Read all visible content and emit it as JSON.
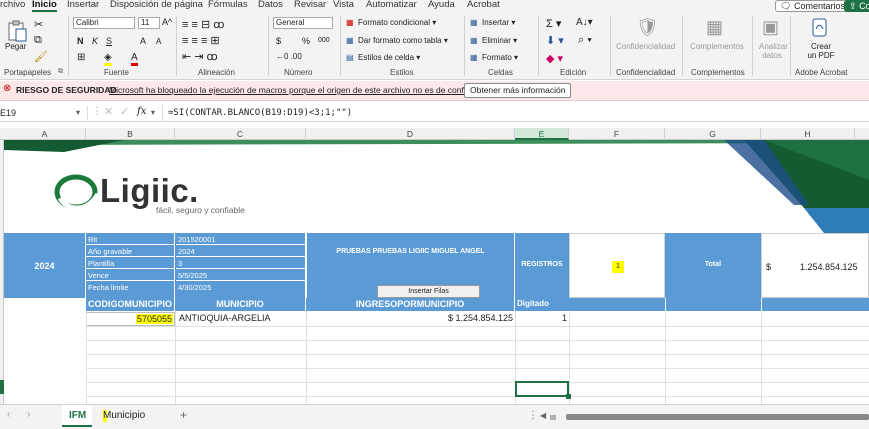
{
  "menu": [
    "rchivo",
    "Inicio",
    "Insertar",
    "Disposición de página",
    "Fórmulas",
    "Datos",
    "Revisar",
    "Vista",
    "Automatizar",
    "Ayuda",
    "Acrobat"
  ],
  "top_buttons": {
    "comments": "Comentarios",
    "share": "Comp"
  },
  "ribbon": {
    "paste": "Pegar",
    "font_name": "Calibri",
    "font_size": "11",
    "bold": "N",
    "italic": "K",
    "underline": "S",
    "grow": "A",
    "shrink": "A",
    "number_format": "General",
    "currency": "$",
    "percent": "%",
    "thousands": "000",
    "cond_format": "Formato condicional",
    "table_format": "Dar formato como tabla",
    "cell_styles": "Estilos de celda",
    "insert": "Insertar",
    "delete": "Eliminar",
    "format": "Formato",
    "conf": "Confidencialidad",
    "compl": "Complementos",
    "analyze": "Analizar datos",
    "create_pdf": "Crear un PDF",
    "groups": [
      "Portapapeles",
      "Fuente",
      "Alineación",
      "Número",
      "Estilos",
      "Celdas",
      "Edición",
      "Confidencialidad",
      "Complementos",
      "Adobe Acrobat"
    ]
  },
  "security": {
    "label": "RIESGO DE SEGURIDAD",
    "message": "Microsoft ha bloqueado la ejecución de macros porque el origen de este archivo no es de confianza.",
    "button": "Obtener más información"
  },
  "formula_bar": {
    "name_box": "E19",
    "fx": "fx",
    "formula": "=SI(CONTAR.BLANCO(B19:D19)<3;1;\"\")"
  },
  "columns": [
    "A",
    "B",
    "C",
    "D",
    "E",
    "F",
    "G",
    "H"
  ],
  "logo": {
    "name": "Ligiic.",
    "tagline": "fácil, seguro y confiable"
  },
  "sheet": {
    "year": "2024",
    "details": [
      [
        "Rit",
        "201520001"
      ],
      [
        "Año gravable",
        "2024"
      ],
      [
        "Plantilla",
        "3"
      ],
      [
        "Vence",
        "5/5/2025"
      ],
      [
        "Fecha limite",
        "4/30/2025"
      ]
    ],
    "title": "PRUEBAS PRUEBAS LIGIIC MIGUEL ANGEL",
    "insert_rows_btn": "Insertar Filas",
    "registros_label": "REGISTROS",
    "registros_value": "1",
    "total_label": "Total",
    "total_currency": "$",
    "total_value": "1.254.854.125",
    "headers": [
      "CODIGOMUNICIPIO",
      "MUNICIPIO",
      "INGRESOPORMUNICIPIO",
      "Digitado"
    ],
    "row": {
      "code": "5705055",
      "municipio": "ANTIOQUIA-ARGELIA",
      "ingreso": "$ 1.254.854.125",
      "digitado": "1"
    }
  },
  "tabs": {
    "active": "IFM",
    "other": "Municipio",
    "add": "+"
  }
}
